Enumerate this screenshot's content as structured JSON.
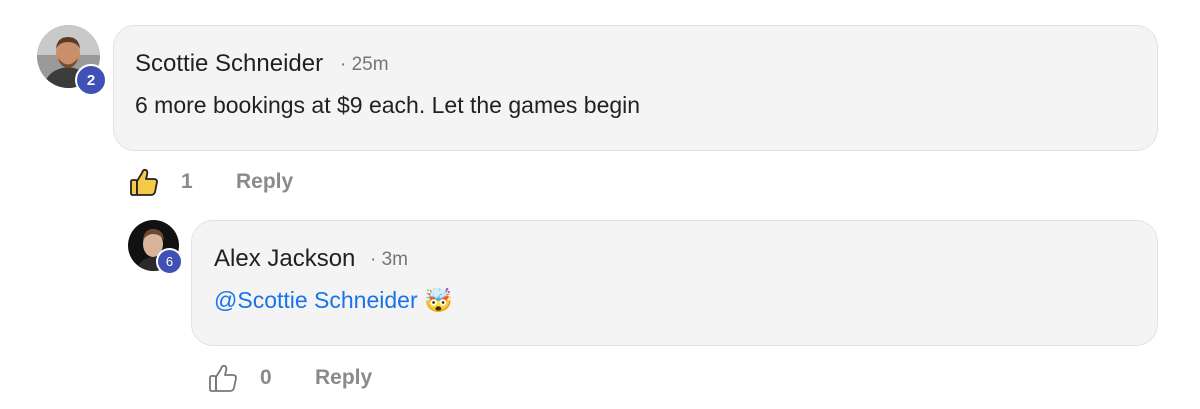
{
  "comments": [
    {
      "author": "Scottie Schneider",
      "separator": "·",
      "time": "25m",
      "text": "6 more bookings at $9 each. Let the games begin",
      "badge": "2",
      "likes": "1",
      "liked": true,
      "reply_label": "Reply"
    },
    {
      "author": "Alex Jackson",
      "separator": "·",
      "time": "3m",
      "mention": "@Scottie Schneider",
      "emoji": "🤯",
      "badge": "6",
      "likes": "0",
      "liked": false,
      "reply_label": "Reply"
    }
  ],
  "colors": {
    "bubble": "#f5f4f4",
    "badge": "#3f51b5",
    "mention": "#1a73e8",
    "like_active": "#f7c948",
    "muted": "#8a8a8a"
  },
  "icons": [
    "thumbs-up-filled-icon",
    "thumbs-up-outline-icon"
  ]
}
